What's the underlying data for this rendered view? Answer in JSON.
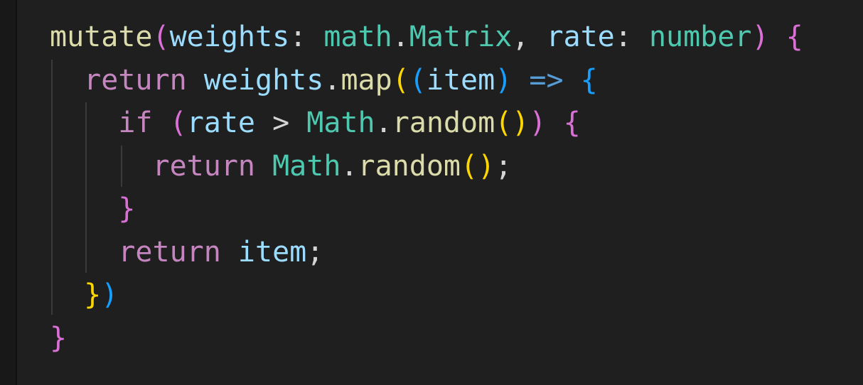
{
  "editor": {
    "language": "typescript",
    "theme_background": "#1f1f1f",
    "colors": {
      "function": "#dcdcaa",
      "variable": "#9cdcfe",
      "type": "#4ec9b0",
      "keyword": "#c586c0",
      "operator": "#569cd6",
      "bracket_level1": "#da70d6",
      "bracket_level2": "#ffd700",
      "bracket_level3": "#179fff",
      "punctuation": "#d4d4d4"
    },
    "lines": [
      {
        "indent": "",
        "tokens": [
          {
            "text": "mutate",
            "kind": "fn"
          },
          {
            "text": "(",
            "kind": "b1"
          },
          {
            "text": "weights",
            "kind": "var"
          },
          {
            "text": ": ",
            "kind": "punc"
          },
          {
            "text": "math",
            "kind": "type"
          },
          {
            "text": ".",
            "kind": "punc"
          },
          {
            "text": "Matrix",
            "kind": "type"
          },
          {
            "text": ", ",
            "kind": "punc"
          },
          {
            "text": "rate",
            "kind": "var"
          },
          {
            "text": ": ",
            "kind": "punc"
          },
          {
            "text": "number",
            "kind": "type"
          },
          {
            "text": ")",
            "kind": "b1"
          },
          {
            "text": " ",
            "kind": "punc"
          },
          {
            "text": "{",
            "kind": "b1"
          }
        ]
      },
      {
        "indent": "  ",
        "tokens": [
          {
            "text": "return",
            "kind": "ctl"
          },
          {
            "text": " ",
            "kind": "punc"
          },
          {
            "text": "weights",
            "kind": "var"
          },
          {
            "text": ".",
            "kind": "punc"
          },
          {
            "text": "map",
            "kind": "fn"
          },
          {
            "text": "(",
            "kind": "b2"
          },
          {
            "text": "(",
            "kind": "b3"
          },
          {
            "text": "item",
            "kind": "var"
          },
          {
            "text": ")",
            "kind": "b3"
          },
          {
            "text": " ",
            "kind": "punc"
          },
          {
            "text": "=>",
            "kind": "op"
          },
          {
            "text": " ",
            "kind": "punc"
          },
          {
            "text": "{",
            "kind": "b3"
          }
        ]
      },
      {
        "indent": "    ",
        "tokens": [
          {
            "text": "if",
            "kind": "ctl"
          },
          {
            "text": " ",
            "kind": "punc"
          },
          {
            "text": "(",
            "kind": "b1"
          },
          {
            "text": "rate",
            "kind": "var"
          },
          {
            "text": " > ",
            "kind": "punc"
          },
          {
            "text": "Math",
            "kind": "type"
          },
          {
            "text": ".",
            "kind": "punc"
          },
          {
            "text": "random",
            "kind": "fn"
          },
          {
            "text": "(",
            "kind": "b2"
          },
          {
            "text": ")",
            "kind": "b2"
          },
          {
            "text": ")",
            "kind": "b1"
          },
          {
            "text": " ",
            "kind": "punc"
          },
          {
            "text": "{",
            "kind": "b1"
          }
        ]
      },
      {
        "indent": "      ",
        "tokens": [
          {
            "text": "return",
            "kind": "ctl"
          },
          {
            "text": " ",
            "kind": "punc"
          },
          {
            "text": "Math",
            "kind": "type"
          },
          {
            "text": ".",
            "kind": "punc"
          },
          {
            "text": "random",
            "kind": "fn"
          },
          {
            "text": "(",
            "kind": "b2"
          },
          {
            "text": ")",
            "kind": "b2"
          },
          {
            "text": ";",
            "kind": "punc"
          }
        ]
      },
      {
        "indent": "    ",
        "tokens": [
          {
            "text": "}",
            "kind": "b1"
          }
        ]
      },
      {
        "indent": "    ",
        "tokens": [
          {
            "text": "return",
            "kind": "ctl"
          },
          {
            "text": " ",
            "kind": "punc"
          },
          {
            "text": "item",
            "kind": "var"
          },
          {
            "text": ";",
            "kind": "punc"
          }
        ]
      },
      {
        "indent": "  ",
        "tokens": [
          {
            "text": "}",
            "kind": "b2"
          },
          {
            "text": ")",
            "kind": "b3"
          }
        ]
      },
      {
        "indent": "",
        "tokens": [
          {
            "text": "}",
            "kind": "b1"
          }
        ]
      }
    ]
  }
}
